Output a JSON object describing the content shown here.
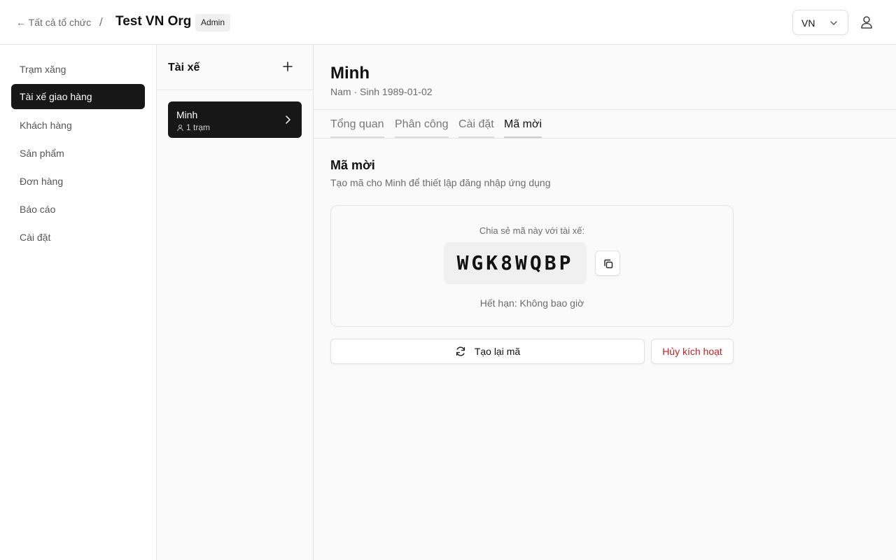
{
  "header": {
    "back_label": "← Tất cả tổ chức",
    "separator": "/",
    "org_name": "Test VN Org",
    "role_badge": "Admin",
    "language": "VN",
    "language_icon": "chevron-down-icon",
    "user_icon": "user-icon"
  },
  "sidebar": {
    "items": [
      {
        "label": "Trạm xăng",
        "active": false
      },
      {
        "label": "Tài xế giao hàng",
        "active": true
      },
      {
        "label": "Khách hàng",
        "active": false
      },
      {
        "label": "Sản phẩm",
        "active": false
      },
      {
        "label": "Đơn hàng",
        "active": false
      },
      {
        "label": "Báo cáo",
        "active": false
      },
      {
        "label": "Cài đặt",
        "active": false
      }
    ]
  },
  "driver_list": {
    "title": "Tài xế",
    "add_icon": "plus-icon",
    "drivers": [
      {
        "name": "Minh",
        "meta": "1 trạm",
        "selected": true
      }
    ]
  },
  "detail": {
    "name": "Minh",
    "subtitle": "Nam · Sinh 1989-01-02",
    "tabs": [
      {
        "label": "Tổng quan",
        "active": false
      },
      {
        "label": "Phân công",
        "active": false
      },
      {
        "label": "Cài đặt",
        "active": false
      },
      {
        "label": "Mã mời",
        "active": true
      }
    ]
  },
  "invite": {
    "title": "Mã mời",
    "description": "Tạo mã cho Minh để thiết lập đăng nhập ứng dụng",
    "share_label": "Chia sẻ mã này với tài xế:",
    "code": "WGK8WQBP",
    "copy_icon": "copy-icon",
    "expiry": "Hết hạn: Không bao giờ",
    "regenerate_label": "Tạo lại mã",
    "regenerate_icon": "refresh-icon",
    "deactivate_label": "Hủy kích hoạt"
  },
  "colors": {
    "active_bg": "#171717",
    "danger": "#c81e1e",
    "border": "#e5e5e5"
  }
}
